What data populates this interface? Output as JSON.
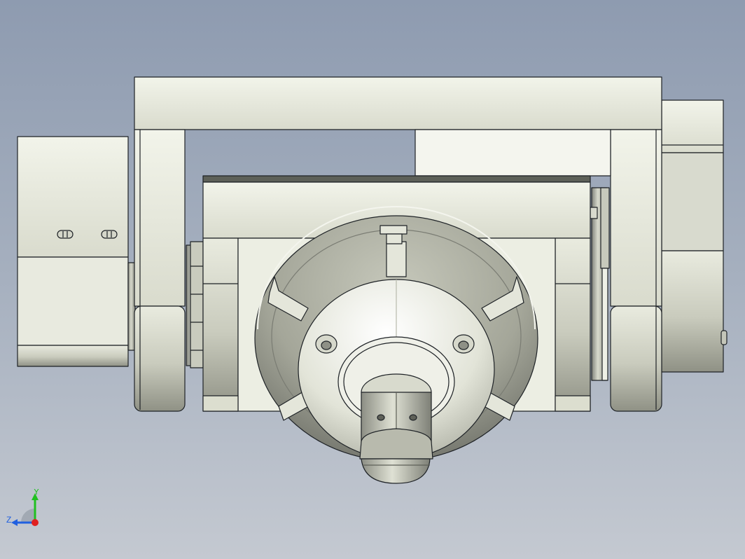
{
  "viewport": {
    "background_top": "#8e9bb0",
    "background_bottom": "#c4c9d1"
  },
  "model": {
    "description_icon": "cad-rotary-table-assembly",
    "edge_color": "#1e2226",
    "body_light": "#eef0e6",
    "body_shade": "#bfc1b3"
  },
  "triad": {
    "x_color": "#e02020",
    "y_color": "#20c020",
    "z_color": "#2060e0",
    "y_label": "Y",
    "z_label": "Z"
  }
}
